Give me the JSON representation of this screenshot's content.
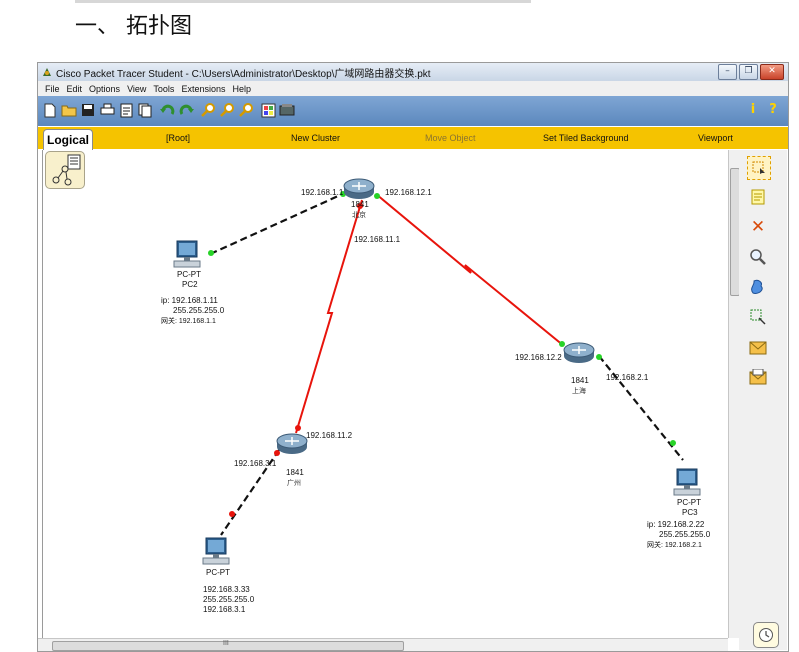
{
  "doc": {
    "heading": "一、 拓扑图"
  },
  "window": {
    "title": "Cisco Packet Tracer Student - C:\\Users\\Administrator\\Desktop\\广域网路由器交换.pkt",
    "buttons": {
      "minimize": "–",
      "maximize": "❐",
      "close": "✕"
    }
  },
  "menu": [
    "File",
    "Edit",
    "Options",
    "View",
    "Tools",
    "Extensions",
    "Help"
  ],
  "toolbar": {
    "info": "i",
    "help": "?"
  },
  "workspace": {
    "tab": "Logical",
    "root": "[Root]",
    "new_cluster": "New Cluster",
    "move_object": "Move Object",
    "tiled_background": "Set Tiled Background",
    "viewport": "Viewport"
  },
  "scroll": {
    "h_mark": "III"
  },
  "topology": {
    "r_beijing": {
      "model": "1841",
      "name": "北京",
      "if_left": "192.168.1.1",
      "if_right": "192.168.12.1",
      "if_down": "192.168.11.1"
    },
    "r_shanghai": {
      "model": "1841",
      "name": "上海",
      "if_left": "192.168.12.2",
      "if_right": "192.168.2.1"
    },
    "r_guangzhou": {
      "model": "1841",
      "name": "广州",
      "if_up": "192.168.11.2",
      "if_left": "192.168.3.1"
    },
    "pc2": {
      "type": "PC-PT",
      "name": "PC2",
      "ip": "ip: 192.168.1.11",
      "mask": "255.255.255.0",
      "gw": "网关: 192.168.1.1"
    },
    "pc3": {
      "type": "PC-PT",
      "name": "PC3",
      "ip": "ip: 192.168.2.22",
      "mask": "255.255.255.0",
      "gw": "网关: 192.168.2.1"
    },
    "pc_gz": {
      "type": "PC-PT",
      "ip": "192.168.3.33",
      "mask": "255.255.255.0",
      "gw": "192.168.3.1"
    }
  },
  "colors": {
    "serial_link": "#e8140c",
    "ethernet_link": "#111111",
    "port_up": "#27d327",
    "port_down": "#e8140c",
    "context_bar": "#f5c300"
  },
  "icons": [
    "packet-tracer-icon",
    "new-file-icon",
    "open-folder-icon",
    "save-icon",
    "print-icon",
    "activity-wizard-icon",
    "copy-icon",
    "undo-icon",
    "redo-icon",
    "zoom-in-icon",
    "zoom-reset-icon",
    "zoom-out-icon",
    "palette-icon",
    "custom-device-icon",
    "select-tool-icon",
    "note-tool-icon",
    "delete-tool-icon",
    "inspect-tool-icon",
    "draw-shape-icon",
    "resize-shape-icon",
    "add-simple-pdu-icon",
    "add-complex-pdu-icon",
    "realtime-clock-icon"
  ]
}
